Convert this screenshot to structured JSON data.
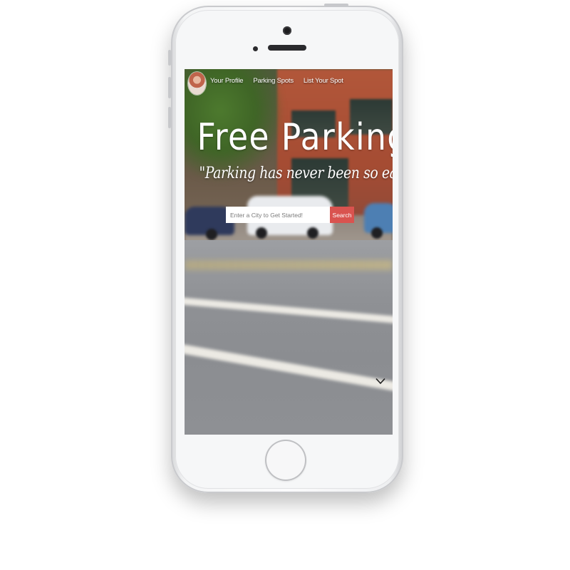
{
  "nav": {
    "items": [
      {
        "label": "Your Profile"
      },
      {
        "label": "Parking Spots"
      },
      {
        "label": "List Your Spot"
      }
    ]
  },
  "hero": {
    "title": "Free Parking",
    "tagline": "\"Parking has never been so easy!\""
  },
  "search": {
    "placeholder": "Enter a City to Get Started!",
    "value": "",
    "button_label": "Search"
  },
  "icons": {
    "scroll": "chevron-down-icon",
    "profile": "avatar"
  },
  "colors": {
    "search_button": "#d9534f",
    "hero_text": "#ffffff"
  }
}
